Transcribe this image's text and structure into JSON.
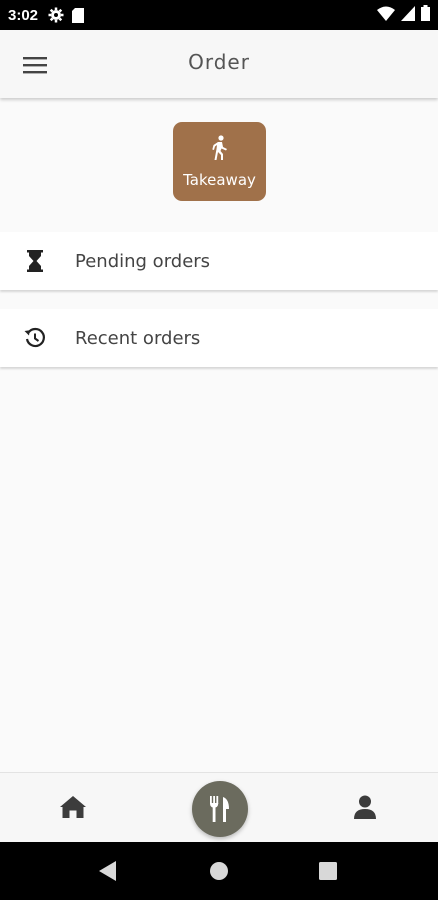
{
  "status_bar": {
    "time": "3:02",
    "icons_left": [
      "gear-icon",
      "sd-card-icon"
    ],
    "icons_right": [
      "wifi-icon",
      "signal-icon",
      "battery-icon"
    ]
  },
  "app_bar": {
    "title": "Order",
    "menu_icon": "hamburger-menu-icon"
  },
  "takeaway": {
    "label": "Takeaway",
    "icon": "walking-person-icon",
    "color": "#a0714a"
  },
  "list": {
    "items": [
      {
        "label": "Pending orders",
        "icon": "hourglass-icon"
      },
      {
        "label": "Recent orders",
        "icon": "history-icon"
      }
    ]
  },
  "bottom_nav": {
    "items": [
      {
        "name": "home",
        "icon": "home-icon"
      },
      {
        "name": "order",
        "icon": "utensils-icon",
        "active": true
      },
      {
        "name": "profile",
        "icon": "user-icon"
      }
    ],
    "active_color": "#6b6b5e"
  },
  "system_nav": {
    "buttons": [
      "back-icon",
      "home-circle-icon",
      "recents-square-icon"
    ]
  }
}
